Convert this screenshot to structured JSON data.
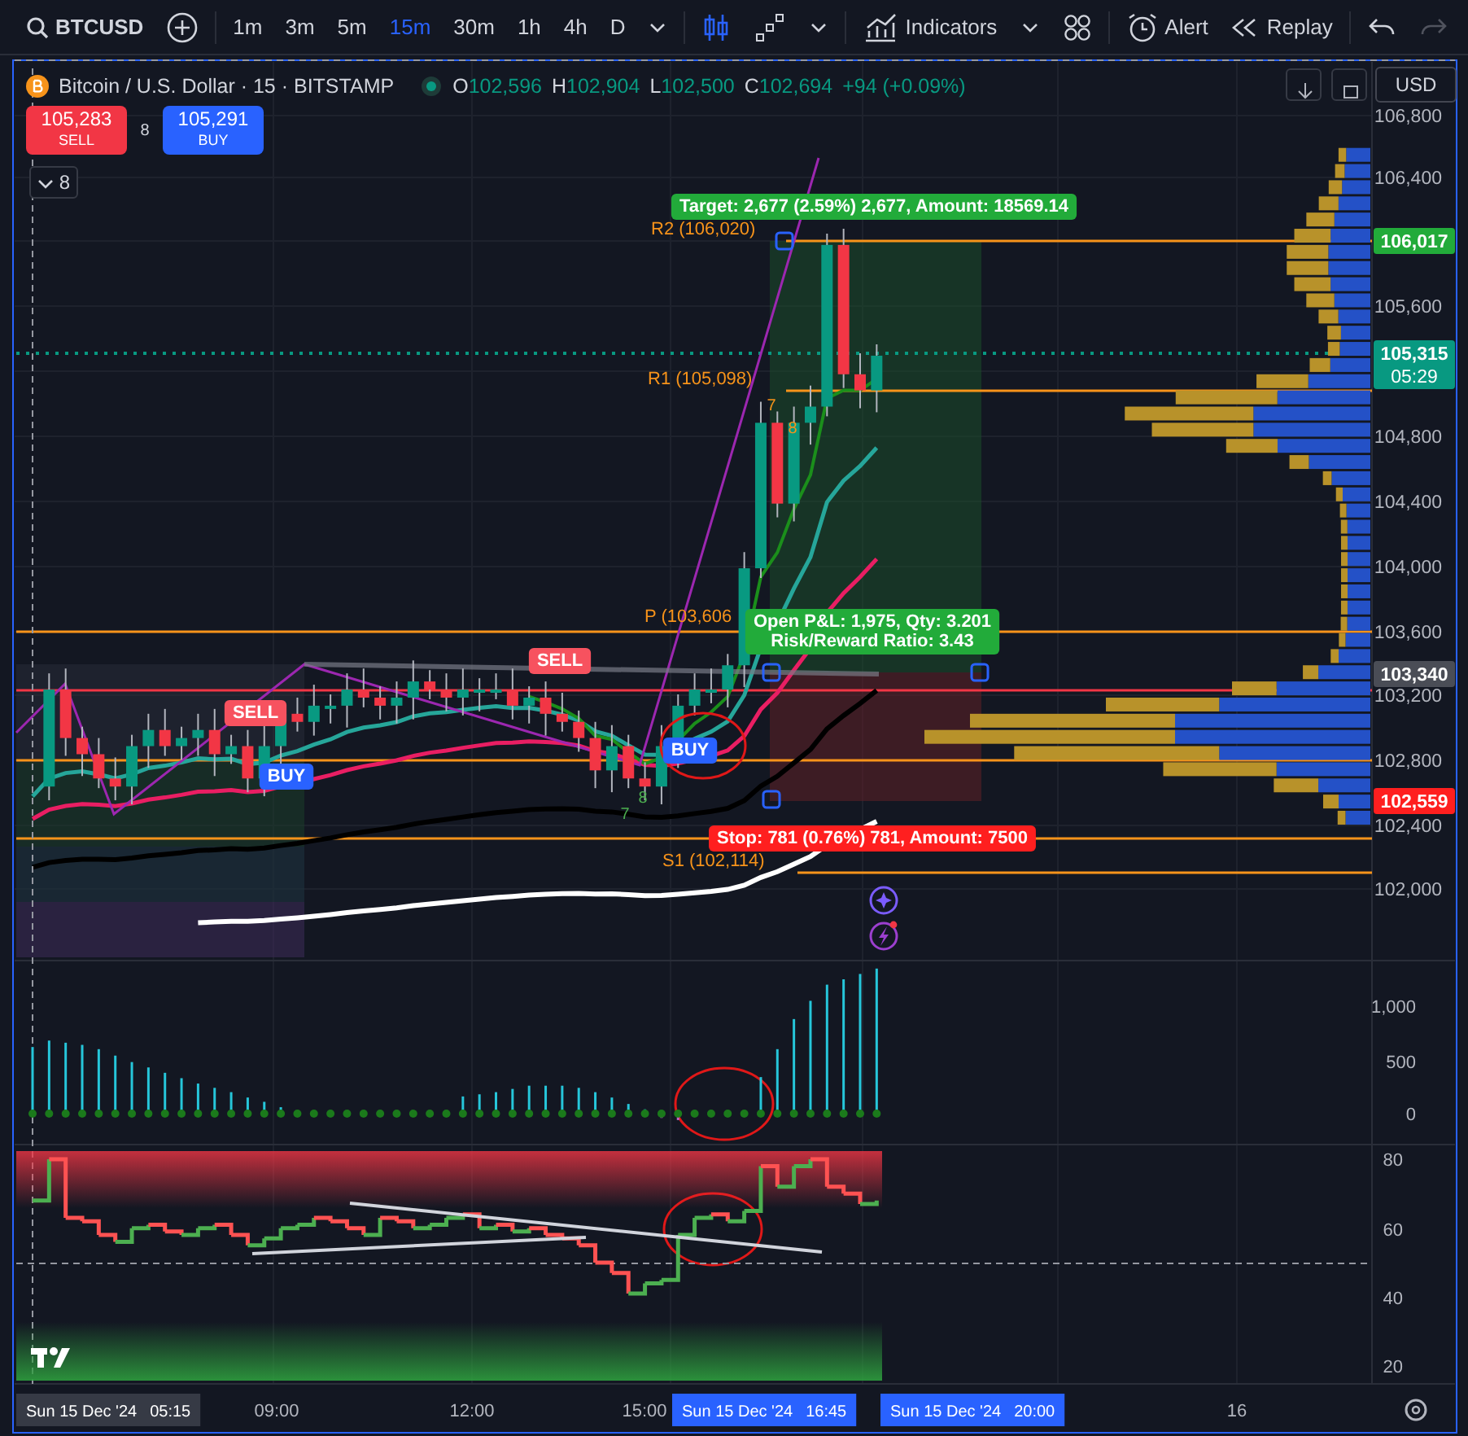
{
  "toolbar": {
    "symbol": "BTCUSD",
    "intervals": [
      {
        "label": "1m",
        "selected": false
      },
      {
        "label": "3m",
        "selected": false
      },
      {
        "label": "5m",
        "selected": false
      },
      {
        "label": "15m",
        "selected": true
      },
      {
        "label": "30m",
        "selected": false
      },
      {
        "label": "1h",
        "selected": false
      },
      {
        "label": "4h",
        "selected": false
      },
      {
        "label": "D",
        "selected": false
      }
    ],
    "indicators": "Indicators",
    "alert": "Alert",
    "replay": "Replay",
    "redo": {
      "disabled": true
    }
  },
  "legend": {
    "title": "Bitcoin / U.S. Dollar · 15 · BITSTAMP",
    "ohlc": [
      {
        "key": "O",
        "value": "102,596"
      },
      {
        "key": "H",
        "value": "102,904"
      },
      {
        "key": "L",
        "value": "102,500"
      },
      {
        "key": "C",
        "value": "102,694"
      }
    ],
    "change": "+94 (+0.09%)",
    "currency": "USD"
  },
  "trade": {
    "sell_price": "105,283",
    "sell_label": "SELL",
    "spread": "8",
    "buy_price": "105,291",
    "buy_label": "BUY",
    "indicators_count": "8"
  },
  "chart": {
    "pivots": [
      "R2 (106,020)",
      "R1 (105,098)",
      "P (103,606",
      "S1 (102,114)"
    ],
    "target_label": "Target: 2,677 (2.59%) 2,677, Amount: 18569.14",
    "position_label": [
      "Open P&L: 1,975, Qty: 3.201",
      "Risk/Reward Ratio: 3.43"
    ],
    "stop_label": "Stop: 781 (0.76%) 781, Amount: 7500",
    "signals": [
      {
        "text": "SELL",
        "kind": "sell"
      },
      {
        "text": "SELL",
        "kind": "sell"
      },
      {
        "text": "BUY",
        "kind": "buy"
      },
      {
        "text": "BUY",
        "kind": "buy"
      }
    ],
    "counts": [
      {
        "text": "7",
        "kind": "down"
      },
      {
        "text": "8",
        "kind": "down"
      },
      {
        "text": "8",
        "kind": "up"
      },
      {
        "text": "7",
        "kind": "up"
      }
    ],
    "price_axis": [
      "106,800",
      "106,400",
      "105,600",
      "104,800",
      "104,400",
      "104,000",
      "103,600",
      "103,200",
      "102,800",
      "102,400",
      "102,000"
    ],
    "price_tags": [
      {
        "text": "106,017",
        "kind": "target"
      },
      {
        "text": "105,315",
        "sub": "05:29",
        "kind": "last"
      },
      {
        "text": "103,340",
        "kind": "entry"
      },
      {
        "text": "102,559",
        "kind": "stop"
      }
    ]
  },
  "oscillator": {
    "axis": [
      "1,000",
      "500",
      "0"
    ]
  },
  "rsi": {
    "axis": [
      "80",
      "60",
      "40",
      "20"
    ]
  },
  "time_axis": {
    "labels": [
      "09:00",
      "12:00",
      "15:00",
      "16"
    ],
    "tags": [
      {
        "date": "Sun 15 Dec '24",
        "time": "05:15",
        "kind": "cursor"
      },
      {
        "date": "Sun 15 Dec '24",
        "time": "16:45",
        "kind": "range"
      },
      {
        "date": "Sun 15 Dec '24",
        "time": "20:00",
        "kind": "range"
      }
    ]
  }
}
